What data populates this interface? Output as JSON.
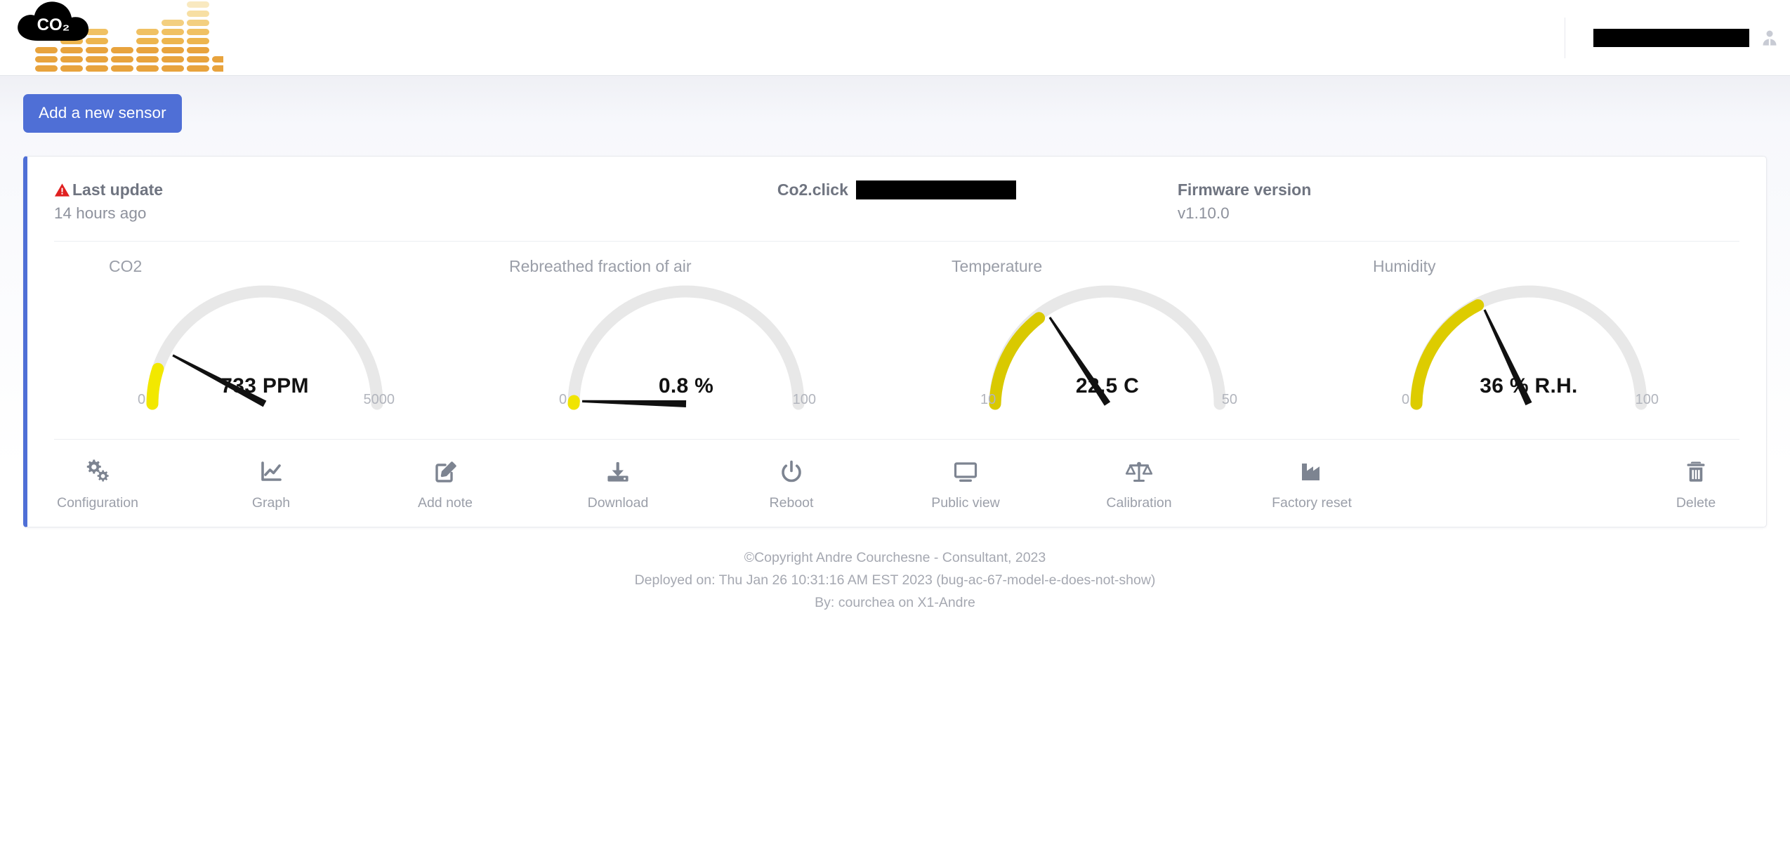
{
  "header": {
    "logo_text": "CO₂",
    "logo_name": "co2-cloud-equalizer-logo",
    "user_name_redacted": "",
    "avatar_icon": "user-avatar-icon"
  },
  "toolbar": {
    "add_sensor_label": "Add a new sensor",
    "accent_color": "#4f6fd6"
  },
  "sensor_card": {
    "last_update": {
      "label": "Last update",
      "value": "14 hours ago",
      "warning_icon": "warning-triangle-icon",
      "warning_color": "#e02020"
    },
    "device": {
      "prefix": "Co2.click",
      "name_redacted": ""
    },
    "firmware": {
      "label": "Firmware version",
      "value": "v1.10.0"
    },
    "gauges": [
      {
        "title": "CO2",
        "value_text": "733 PPM",
        "min_label": "0",
        "max_label": "5000",
        "arc_color": "#f2e800"
      },
      {
        "title": "Rebreathed fraction of air",
        "value_text": "0.8 %",
        "min_label": "0",
        "max_label": "100",
        "arc_color": "#f0e400"
      },
      {
        "title": "Temperature",
        "value_text": "22.5 C",
        "min_label": "10",
        "max_label": "50",
        "arc_color": "#d9c900"
      },
      {
        "title": "Humidity",
        "value_text": "36 % R.H.",
        "min_label": "0",
        "max_label": "100",
        "arc_color": "#ddcc00"
      }
    ],
    "actions": [
      {
        "label": "Configuration",
        "icon": "gears-icon"
      },
      {
        "label": "Graph",
        "icon": "line-chart-icon"
      },
      {
        "label": "Add note",
        "icon": "pencil-square-icon"
      },
      {
        "label": "Download",
        "icon": "download-tray-icon"
      },
      {
        "label": "Reboot",
        "icon": "power-icon"
      },
      {
        "label": "Public view",
        "icon": "monitor-icon"
      },
      {
        "label": "Calibration",
        "icon": "balance-scale-icon"
      },
      {
        "label": "Factory reset",
        "icon": "factory-icon"
      }
    ],
    "delete_action": {
      "label": "Delete",
      "icon": "trash-icon"
    }
  },
  "footer": {
    "line1": "©Copyright Andre Courchesne - Consultant, 2023",
    "line2": "Deployed on: Thu Jan 26 10:31:16 AM EST 2023 (bug-ac-67-model-e-does-not-show)",
    "line3": "By: courchea on X1-Andre"
  },
  "chart_data": [
    {
      "type": "gauge",
      "title": "CO2",
      "value": 733,
      "unit": "PPM",
      "ylim": [
        0,
        5000
      ],
      "tick_labels": [
        "0",
        "5000"
      ],
      "arc_color": "#f2e800",
      "track_color": "#e8e8e8"
    },
    {
      "type": "gauge",
      "title": "Rebreathed fraction of air",
      "value": 0.8,
      "unit": "%",
      "ylim": [
        0,
        100
      ],
      "tick_labels": [
        "0",
        "100"
      ],
      "arc_color": "#f0e400",
      "track_color": "#e8e8e8"
    },
    {
      "type": "gauge",
      "title": "Temperature",
      "value": 22.5,
      "unit": "C",
      "ylim": [
        10,
        50
      ],
      "tick_labels": [
        "10",
        "50"
      ],
      "arc_color": "#d9c900",
      "track_color": "#e8e8e8"
    },
    {
      "type": "gauge",
      "title": "Humidity",
      "value": 36,
      "unit": "% R.H.",
      "ylim": [
        0,
        100
      ],
      "tick_labels": [
        "0",
        "100"
      ],
      "arc_color": "#ddcc00",
      "track_color": "#e8e8e8"
    }
  ]
}
